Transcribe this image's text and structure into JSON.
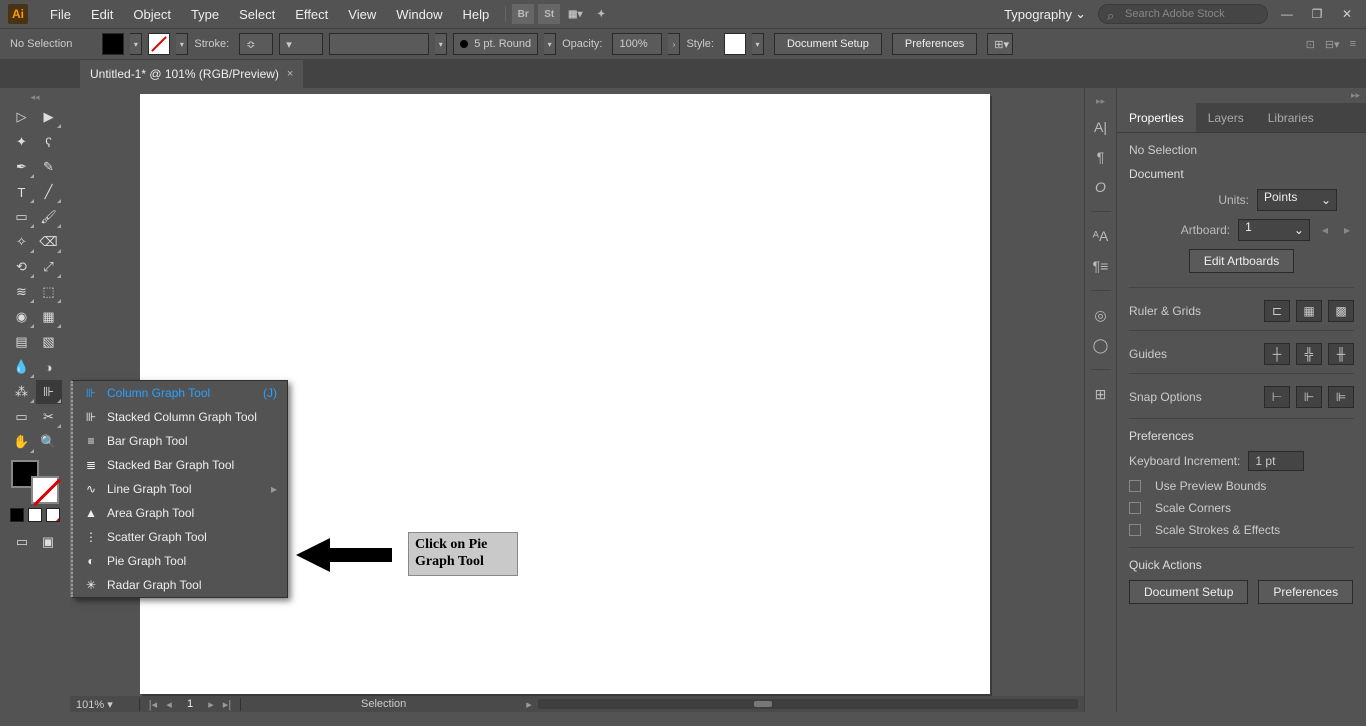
{
  "menubar": {
    "logo": "Ai",
    "items": [
      "File",
      "Edit",
      "Object",
      "Type",
      "Select",
      "Effect",
      "View",
      "Window",
      "Help"
    ],
    "squares": [
      "Br",
      "St"
    ],
    "workspace": "Typography",
    "search_placeholder": "Search Adobe Stock"
  },
  "controlbar": {
    "selection_label": "No Selection",
    "stroke_label": "Stroke:",
    "brush_label": "5 pt. Round",
    "opacity_label": "Opacity:",
    "opacity_value": "100%",
    "style_label": "Style:",
    "doc_setup": "Document Setup",
    "prefs": "Preferences"
  },
  "doc_tab": "Untitled-1* @ 101% (RGB/Preview)",
  "statusbar": {
    "zoom": "101%",
    "artboard_num": "1",
    "mode": "Selection"
  },
  "flyout": {
    "items": [
      {
        "icon": "⊪",
        "label": "Column Graph Tool",
        "shortcut": "(J)"
      },
      {
        "icon": "⊪",
        "label": "Stacked Column Graph Tool"
      },
      {
        "icon": "≡",
        "label": "Bar Graph Tool"
      },
      {
        "icon": "≣",
        "label": "Stacked Bar Graph Tool"
      },
      {
        "icon": "∿",
        "label": "Line Graph Tool"
      },
      {
        "icon": "▲",
        "label": "Area Graph Tool"
      },
      {
        "icon": "⋮",
        "label": "Scatter Graph Tool"
      },
      {
        "icon": "◐",
        "label": "Pie Graph Tool"
      },
      {
        "icon": "✳",
        "label": "Radar Graph Tool"
      }
    ]
  },
  "annotation": "Click on Pie Graph Tool",
  "properties": {
    "tab_properties": "Properties",
    "tab_layers": "Layers",
    "tab_libraries": "Libraries",
    "no_selection": "No Selection",
    "document_heading": "Document",
    "units_label": "Units:",
    "units_value": "Points",
    "artboard_label": "Artboard:",
    "artboard_value": "1",
    "edit_artboards": "Edit Artboards",
    "ruler_grids": "Ruler & Grids",
    "guides": "Guides",
    "snap_options": "Snap Options",
    "preferences": "Preferences",
    "keyboard_increment_label": "Keyboard Increment:",
    "keyboard_increment_value": "1 pt",
    "use_preview_bounds": "Use Preview Bounds",
    "scale_corners": "Scale Corners",
    "scale_strokes": "Scale Strokes & Effects",
    "quick_actions": "Quick Actions",
    "qa_doc_setup": "Document Setup",
    "qa_prefs": "Preferences"
  }
}
